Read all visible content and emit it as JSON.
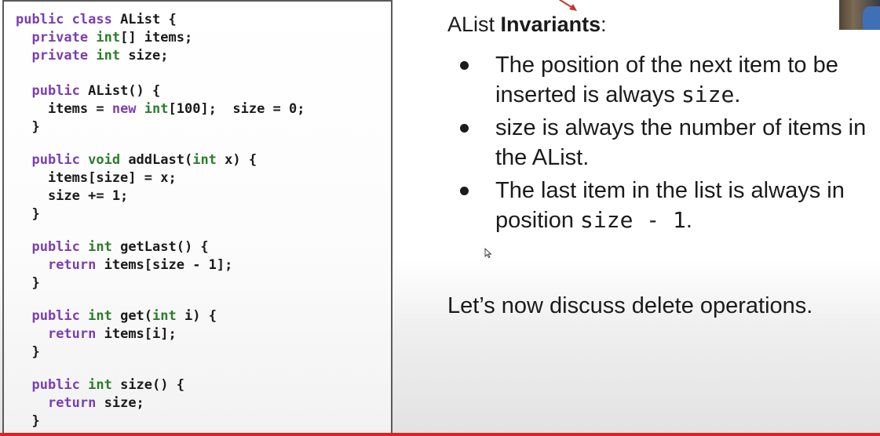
{
  "code": {
    "lines": [
      {
        "parts": [
          {
            "t": "public class ",
            "c": "kw"
          },
          {
            "t": "AList {",
            "c": ""
          }
        ]
      },
      {
        "parts": [
          {
            "t": "  private ",
            "c": "kw"
          },
          {
            "t": "int",
            "c": "ty"
          },
          {
            "t": "[] items;",
            "c": ""
          }
        ]
      },
      {
        "parts": [
          {
            "t": "  private ",
            "c": "kw"
          },
          {
            "t": "int",
            "c": "ty"
          },
          {
            "t": " size;",
            "c": ""
          }
        ]
      },
      {
        "gap": "large"
      },
      {
        "parts": [
          {
            "t": "  public ",
            "c": "kw"
          },
          {
            "t": "AList() {",
            "c": ""
          }
        ]
      },
      {
        "parts": [
          {
            "t": "    items = ",
            "c": ""
          },
          {
            "t": "new ",
            "c": "kw"
          },
          {
            "t": "int",
            "c": "ty"
          },
          {
            "t": "[100];  size = 0;",
            "c": ""
          }
        ]
      },
      {
        "parts": [
          {
            "t": "  }",
            "c": ""
          }
        ]
      },
      {
        "gap": "small"
      },
      {
        "parts": [
          {
            "t": "  public ",
            "c": "kw"
          },
          {
            "t": "void",
            "c": "ty"
          },
          {
            "t": " addLast(",
            "c": ""
          },
          {
            "t": "int",
            "c": "ty"
          },
          {
            "t": " x) {",
            "c": ""
          }
        ]
      },
      {
        "parts": [
          {
            "t": "    items[size] = x;",
            "c": ""
          }
        ]
      },
      {
        "parts": [
          {
            "t": "    size += 1;",
            "c": ""
          }
        ]
      },
      {
        "parts": [
          {
            "t": "  }",
            "c": ""
          }
        ]
      },
      {
        "gap": "small"
      },
      {
        "parts": [
          {
            "t": "  public ",
            "c": "kw"
          },
          {
            "t": "int",
            "c": "ty"
          },
          {
            "t": " getLast() {",
            "c": ""
          }
        ]
      },
      {
        "parts": [
          {
            "t": "    ",
            "c": ""
          },
          {
            "t": "return",
            "c": "kw"
          },
          {
            "t": " items[size - 1];",
            "c": ""
          }
        ]
      },
      {
        "parts": [
          {
            "t": "  }",
            "c": ""
          }
        ]
      },
      {
        "gap": "small"
      },
      {
        "parts": [
          {
            "t": "  public ",
            "c": "kw"
          },
          {
            "t": "int",
            "c": "ty"
          },
          {
            "t": " get(",
            "c": ""
          },
          {
            "t": "int",
            "c": "ty"
          },
          {
            "t": " i) {",
            "c": ""
          }
        ]
      },
      {
        "parts": [
          {
            "t": "    ",
            "c": ""
          },
          {
            "t": "return",
            "c": "kw"
          },
          {
            "t": " items[i];",
            "c": ""
          }
        ]
      },
      {
        "parts": [
          {
            "t": "  }",
            "c": ""
          }
        ]
      },
      {
        "gap": "small"
      },
      {
        "parts": [
          {
            "t": "  public ",
            "c": "kw"
          },
          {
            "t": "int",
            "c": "ty"
          },
          {
            "t": " size() {",
            "c": ""
          }
        ]
      },
      {
        "parts": [
          {
            "t": "    ",
            "c": ""
          },
          {
            "t": "return",
            "c": "kw"
          },
          {
            "t": " size;",
            "c": ""
          }
        ]
      },
      {
        "parts": [
          {
            "t": "  }",
            "c": ""
          }
        ]
      }
    ],
    "colors": {
      "keyword": "#7b3fb0",
      "type": "#2c7d2c",
      "text": "#1a1a1a"
    }
  },
  "slide": {
    "heading_prefix": "AList ",
    "heading_bold": "Invariants",
    "heading_suffix": ":",
    "bullets": [
      {
        "parts": [
          {
            "t": "The position of the next item to be inserted is always ",
            "mono": false
          },
          {
            "t": "size",
            "mono": true
          },
          {
            "t": ".",
            "mono": false
          }
        ]
      },
      {
        "parts": [
          {
            "t": "size is always the number of items in the AList.",
            "mono": false
          }
        ]
      },
      {
        "parts": [
          {
            "t": "The last item in the list is always in position ",
            "mono": false
          },
          {
            "t": "size - 1",
            "mono": true
          },
          {
            "t": ".",
            "mono": false
          }
        ]
      }
    ],
    "discuss": "Let’s now discuss delete operations."
  },
  "icons": {
    "cursor": "mouse-pointer-icon",
    "arrow": "red-annotation-arrow-icon"
  },
  "accent_colors": {
    "annotation_red": "#e02020",
    "panel_border": "#5a5a5a"
  }
}
